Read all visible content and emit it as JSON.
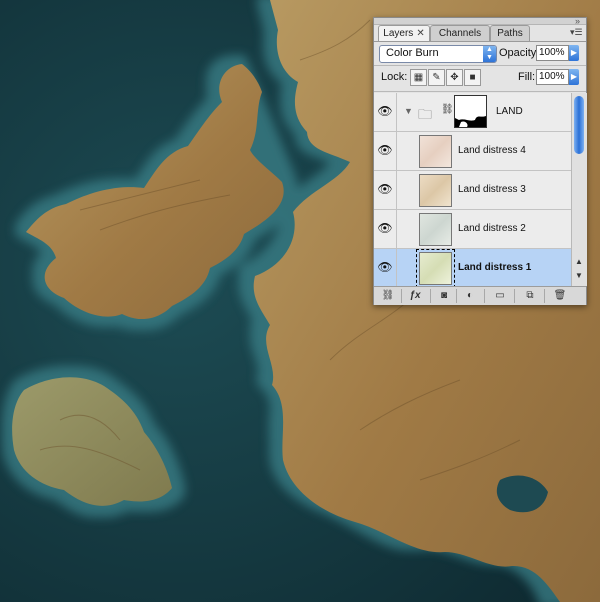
{
  "panel": {
    "tabs": [
      {
        "label": "Layers",
        "active": true
      },
      {
        "label": "Channels",
        "active": false
      },
      {
        "label": "Paths",
        "active": false
      }
    ],
    "blend_mode": "Color Burn",
    "opacity_label": "Opacity:",
    "opacity_value": "100%",
    "lock_label": "Lock:",
    "fill_label": "Fill:",
    "fill_value": "100%",
    "layers": [
      {
        "name": "LAND",
        "type": "group",
        "visible": true,
        "selected": false
      },
      {
        "name": "Land distress 4",
        "type": "layer",
        "visible": true,
        "selected": false,
        "color": "#eddcd0"
      },
      {
        "name": "Land distress 3",
        "type": "layer",
        "visible": true,
        "selected": false,
        "color": "#e5d7bd"
      },
      {
        "name": "Land distress 2",
        "type": "layer",
        "visible": true,
        "selected": false,
        "color": "#d9dfd8"
      },
      {
        "name": "Land distress 1",
        "type": "layer",
        "visible": true,
        "selected": true,
        "color": "#dfe6c8"
      }
    ]
  },
  "colors": {
    "sea_deep": "#13343c",
    "sea_shallow": "#2f6f76",
    "land": "#a8884f",
    "selection": "#b7d3f5",
    "accent": "#2f74d8"
  }
}
